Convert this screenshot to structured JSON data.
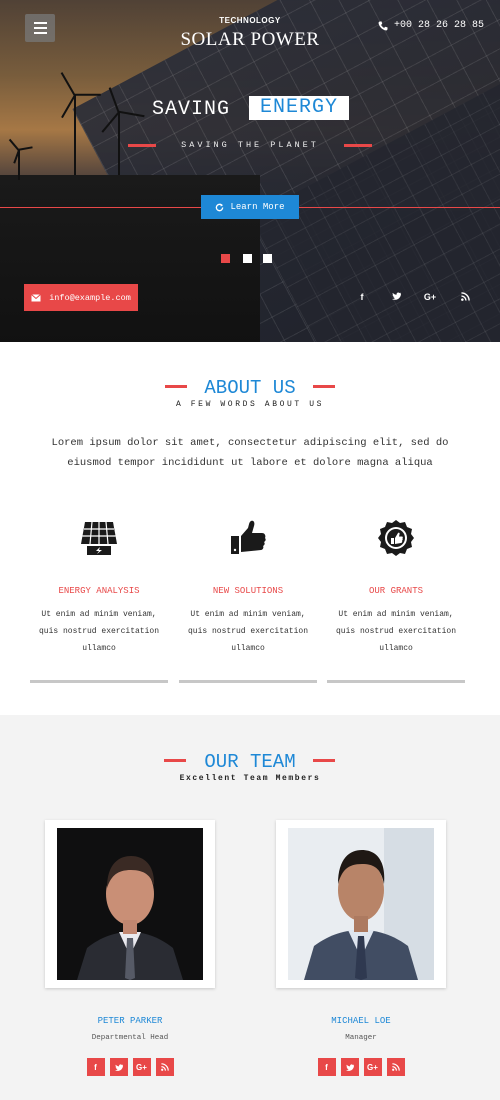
{
  "header": {
    "menu_icon": "hamburger-icon",
    "brand_sub": "TECHNOLOGY",
    "brand_title": "SOLAR POWER",
    "phone_icon": "phone-icon",
    "phone": "+00 28 26 28 85"
  },
  "hero": {
    "headline_a": "SAVING",
    "headline_b": "ENERGY",
    "subline": "SAVING THE PLANET",
    "cta_icon": "refresh-icon",
    "cta_label": "Learn More",
    "slides": {
      "count": 3,
      "active": 1
    },
    "email_icon": "envelope-icon",
    "email": "info@example.com",
    "social": [
      "f",
      "t",
      "G+",
      "rss"
    ]
  },
  "about": {
    "title": "ABOUT US",
    "subtitle": "A FEW WORDS ABOUT US",
    "intro": "Lorem ipsum dolor sit amet, consectetur adipiscing elit, sed do eiusmod tempor incididunt ut labore et dolore magna aliqua",
    "features": [
      {
        "icon": "solar-panel-icon",
        "name": "ENERGY ANALYSIS",
        "desc": "Ut enim ad minim veniam, quis nostrud exercitation ullamco"
      },
      {
        "icon": "thumbs-up-icon",
        "name": "NEW SOLUTIONS",
        "desc": "Ut enim ad minim veniam, quis nostrud exercitation ullamco"
      },
      {
        "icon": "award-badge-icon",
        "name": "OUR GRANTS",
        "desc": "Ut enim ad minim veniam, quis nostrud exercitation ullamco"
      }
    ]
  },
  "team": {
    "title": "OUR TEAM",
    "subtitle": "Excellent Team Members",
    "members": [
      {
        "name": "PETER PARKER",
        "role": "Departmental Head",
        "social": [
          "f",
          "t",
          "G+",
          "rss"
        ]
      },
      {
        "name": "MICHAEL LOE",
        "role": "Manager",
        "social": [
          "f",
          "t",
          "G+",
          "rss"
        ]
      }
    ]
  },
  "colors": {
    "accent_red": "#e84848",
    "accent_blue": "#1e88d6"
  }
}
